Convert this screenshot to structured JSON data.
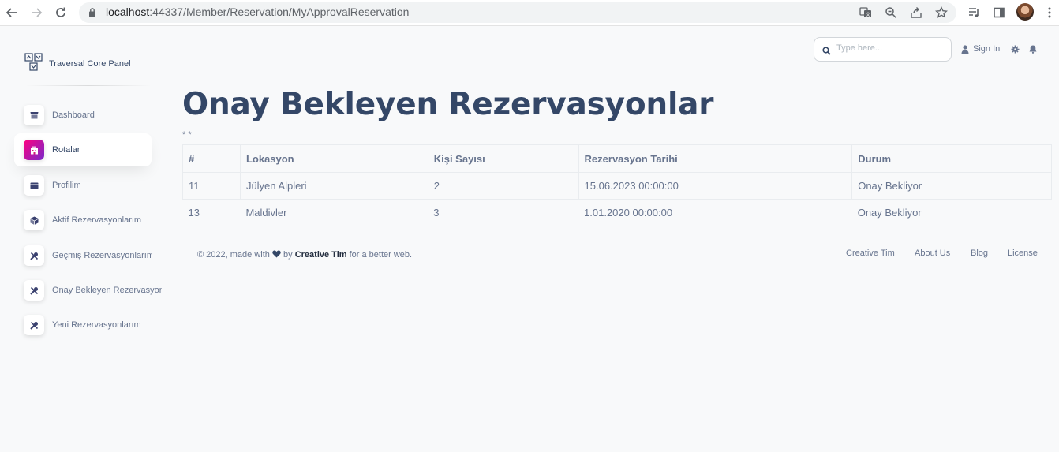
{
  "browser": {
    "url_host": "localhost",
    "url_path": ":44337/Member/Reservation/MyApprovalReservation"
  },
  "brand": {
    "name": "Traversal Core Panel",
    "icon": "map-icon"
  },
  "sidebar": {
    "items": [
      {
        "label": "Dashboard",
        "icon": "shop-icon",
        "active": false
      },
      {
        "label": "Rotalar",
        "icon": "building-icon",
        "active": true
      },
      {
        "label": "Profilim",
        "icon": "credit-card-icon",
        "active": false
      },
      {
        "label": "Aktif Rezervasyonlarım",
        "icon": "box-icon",
        "active": false
      },
      {
        "label": "Geçmiş Rezervasyonlarım",
        "icon": "settings-tools-icon",
        "active": false
      },
      {
        "label": "Onay Bekleyen Rezervasyonlarım",
        "icon": "settings-tools-icon",
        "active": false
      },
      {
        "label": "Yeni Rezervasyonlarım",
        "icon": "settings-tools-icon",
        "active": false
      }
    ]
  },
  "topnav": {
    "search_placeholder": "Type here...",
    "signin_label": "Sign In"
  },
  "main": {
    "title": "Onay Bekleyen Rezervasyonlar",
    "stars": "* *",
    "table": {
      "headers": [
        "#",
        "Lokasyon",
        "Kişi Sayısı",
        "Rezervasyon Tarihi",
        "Durum"
      ],
      "rows": [
        [
          "11",
          "Jülyen Alpleri",
          "2",
          "15.06.2023 00:00:00",
          "Onay Bekliyor"
        ],
        [
          "13",
          "Maldivler",
          "3",
          "1.01.2020 00:00:00",
          "Onay Bekliyor"
        ]
      ]
    }
  },
  "footer": {
    "copyright_prefix": "© 2022, made with",
    "by_text": "by",
    "author": "Creative Tim",
    "suffix": "for a better web.",
    "links": [
      "Creative Tim",
      "About Us",
      "Blog",
      "License"
    ]
  },
  "colors": {
    "accent_from": "#7928ca",
    "accent_to": "#ff0080",
    "heading": "#344767",
    "text": "#67748e"
  }
}
